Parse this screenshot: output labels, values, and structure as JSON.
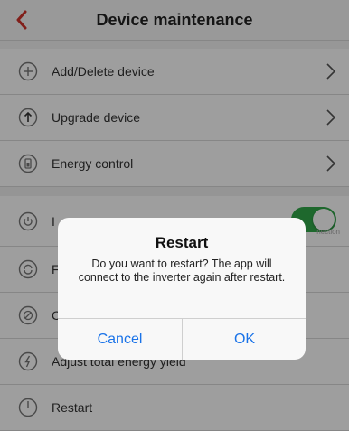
{
  "header": {
    "title": "Device maintenance",
    "back_icon": "chevron-left-icon",
    "accent_color": "#d0332a"
  },
  "list": {
    "items": [
      {
        "label": "Add/Delete device",
        "icon": "plus-circle-icon",
        "action": "chevron"
      },
      {
        "label": "Upgrade device",
        "icon": "upload-arrow-icon",
        "action": "chevron"
      },
      {
        "label": "Energy control",
        "icon": "battery-icon",
        "action": "chevron"
      },
      {
        "label": "I",
        "icon": "power-icon",
        "action": "toggle",
        "toggle_on": true,
        "caption": "nection"
      },
      {
        "label": "F",
        "icon": "refresh-icon",
        "action": "none"
      },
      {
        "label": "C",
        "icon": "no-entry-icon",
        "action": "none"
      },
      {
        "label": "Adjust total energy yield",
        "icon": "lightning-icon",
        "action": "none"
      },
      {
        "label": "Restart",
        "icon": "power-icon",
        "action": "none"
      }
    ]
  },
  "dialog": {
    "title": "Restart",
    "message": "Do you want to restart? The app will connect to the inverter again after restart.",
    "cancel_label": "Cancel",
    "ok_label": "OK",
    "button_color": "#1a73e8"
  },
  "colors": {
    "toggle_on": "#31a84a"
  }
}
